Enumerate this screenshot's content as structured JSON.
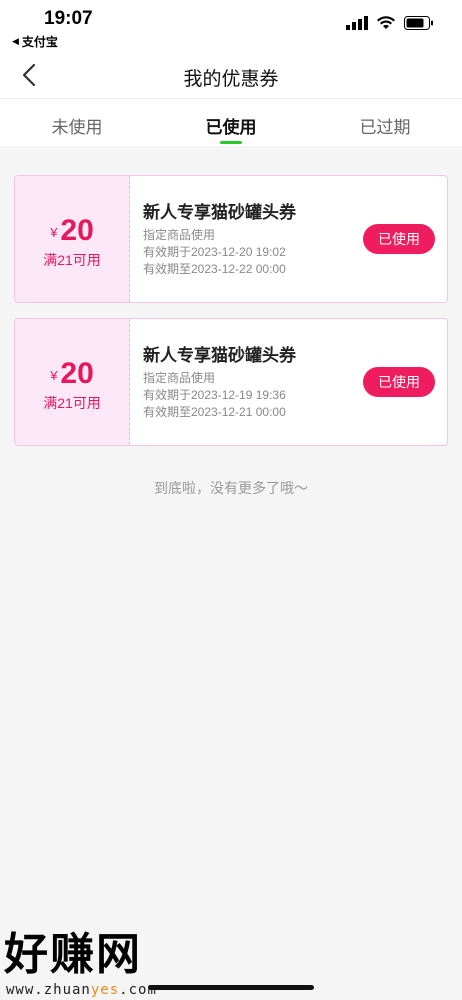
{
  "status_bar": {
    "time": "19:07",
    "back_app": "支付宝",
    "icons": [
      "signal-icon",
      "wifi-icon",
      "battery-icon"
    ]
  },
  "nav": {
    "title": "我的优惠券",
    "back_icon": "chevron-left-icon"
  },
  "tabs": [
    {
      "label": "未使用",
      "active": false
    },
    {
      "label": "已使用",
      "active": true
    },
    {
      "label": "已过期",
      "active": false
    }
  ],
  "coupons": [
    {
      "currency": "¥",
      "amount": "20",
      "condition": "满21可用",
      "title": "新人专享猫砂罐头券",
      "scope": "指定商品使用",
      "valid_from": "有效期于2023-12-20 19:02",
      "valid_to": "有效期至2023-12-22 00:00",
      "status": "已使用"
    },
    {
      "currency": "¥",
      "amount": "20",
      "condition": "满21可用",
      "title": "新人专享猫砂罐头券",
      "scope": "指定商品使用",
      "valid_from": "有效期于2023-12-19 19:36",
      "valid_to": "有效期至2023-12-21 00:00",
      "status": "已使用"
    }
  ],
  "end_text": "到底啦，没有更多了哦～",
  "watermark": {
    "big": "好赚网",
    "url_prefix": "www.zhuan",
    "url_highlight": "yes",
    "url_suffix": ".com"
  },
  "colors": {
    "accent": "#ef1d5f",
    "tab_indicator": "#2bc82b",
    "coupon_left_bg": "#fde8f7"
  }
}
